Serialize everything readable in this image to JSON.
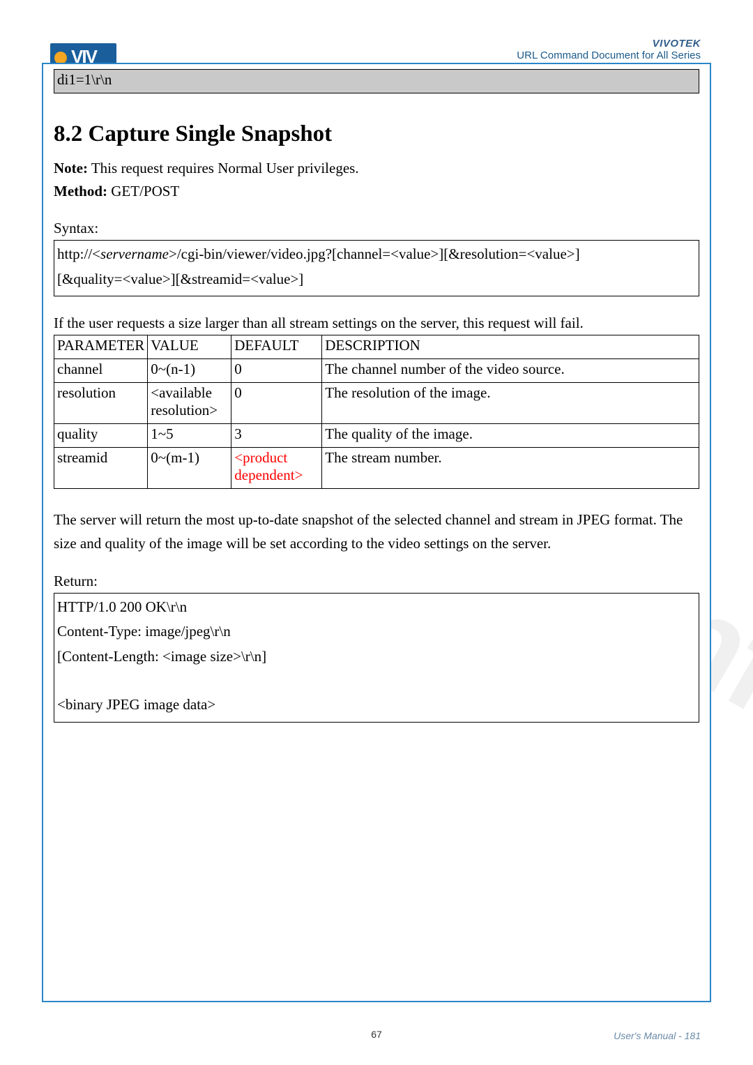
{
  "header": {
    "brand": "VIVOTEK",
    "doc_title": "URL Command Document for All Series",
    "logo_text": "VIV"
  },
  "di_box": "di1=1\\r\\n",
  "section": {
    "number": "8.2",
    "title": "Capture Single Snapshot"
  },
  "note": {
    "label": "Note:",
    "text": " This request requires Normal User privileges."
  },
  "method": {
    "label": "Method:",
    "value": " GET/POST"
  },
  "syntax": {
    "label": "Syntax:",
    "line1_a": "http://<",
    "line1_server": "servername",
    "line1_b": ">/cgi-bin/viewer/video.jpg?[channel=<value>][&resolution=<value>]",
    "line2": "[&quality=<value>][&streamid=<value>]"
  },
  "fail_note": "If the user requests a size larger than all stream settings on the server, this request will fail.",
  "table": {
    "headers": {
      "parameter": "PARAMETER",
      "value": "VALUE",
      "default": "DEFAULT",
      "description": "DESCRIPTION"
    },
    "rows": [
      {
        "parameter": "channel",
        "value": "0~(n-1)",
        "default": "0",
        "default_red": false,
        "description": "The channel number of the video source."
      },
      {
        "parameter": "resolution",
        "value": "<available resolution>",
        "default": "0",
        "default_red": false,
        "description": "The resolution of the image."
      },
      {
        "parameter": "quality",
        "value": "1~5",
        "default": "3",
        "default_red": false,
        "description": "The quality of the image."
      },
      {
        "parameter": "streamid",
        "value": "0~(m-1)",
        "default": "<product dependent>",
        "default_red": true,
        "description": "The stream number."
      }
    ]
  },
  "desc_para": "The server will return the most up-to-date snapshot of the selected channel and stream in JPEG format. The size and quality of the image will be set according to the video settings on the server.",
  "return": {
    "label": "Return:",
    "lines": [
      "HTTP/1.0 200 OK\\r\\n",
      "Content-Type: image/jpeg\\r\\n",
      "[Content-Length: <image size>\\r\\n]",
      "",
      "<binary JPEG image data>"
    ]
  },
  "footer": {
    "center_page": "67",
    "right_label": "User's Manual - ",
    "right_page": "181"
  }
}
